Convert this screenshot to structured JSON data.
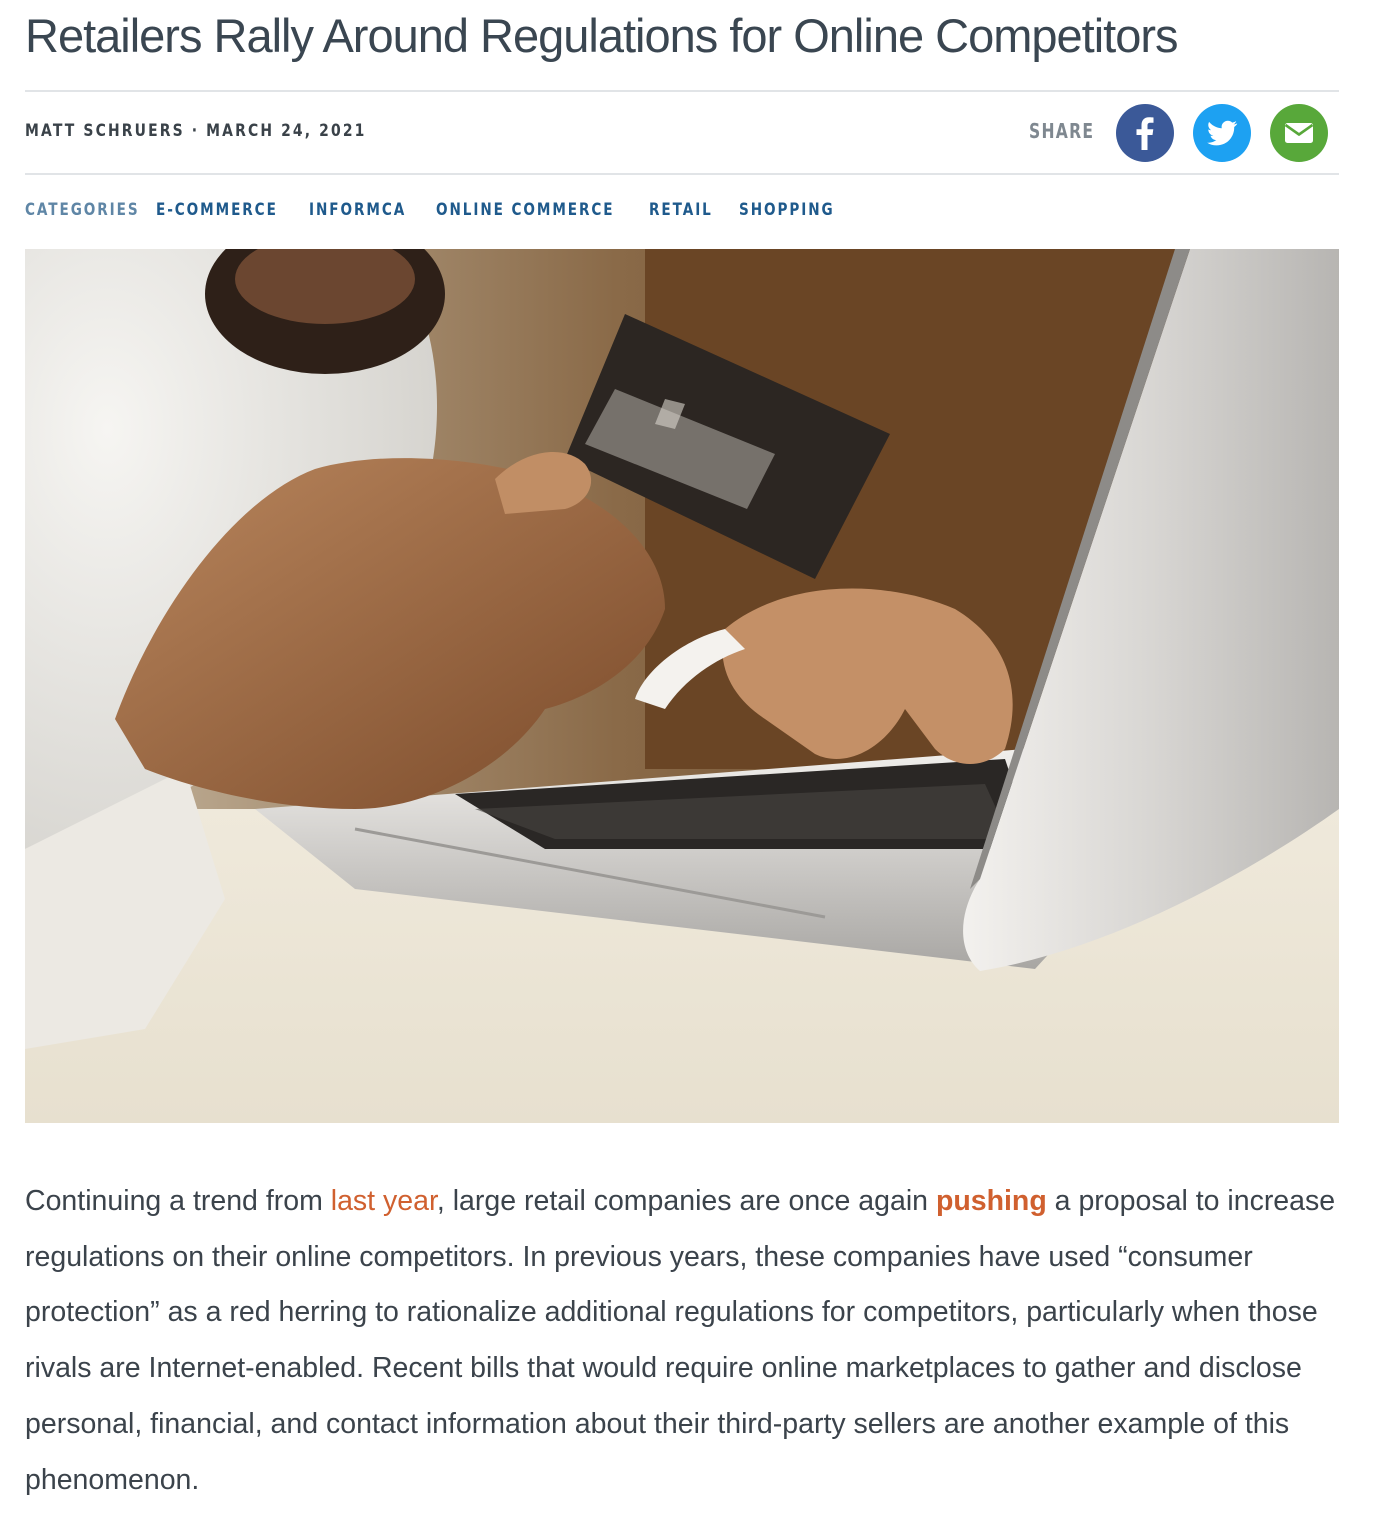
{
  "article": {
    "title": "Retailers Rally Around Regulations for Online Competitors",
    "byline": "MATT SCHRUERS · MARCH 24, 2021"
  },
  "share": {
    "label": "SHARE",
    "buttons": [
      {
        "icon": "facebook-icon",
        "color": "#3b5998"
      },
      {
        "icon": "twitter-icon",
        "color": "#1da1f2"
      },
      {
        "icon": "email-icon",
        "color": "#58a83a"
      }
    ]
  },
  "categories": {
    "label": "CATEGORIES",
    "items": [
      "E-COMMERCE",
      "INFORMCA",
      "ONLINE COMMERCE",
      "RETAIL",
      "SHOPPING"
    ]
  },
  "body": {
    "p1_before_link1": "Continuing a trend from ",
    "link1": "last year",
    "p1_between": ", large retail companies are once again ",
    "link2": "pushing",
    "p1_after": " a proposal to increase regulations on their online competitors.  In previous years, these companies have used “consumer protection” as a red herring to rationalize additional regulations for competitors, particularly when those rivals are Internet-enabled.  Recent bills that would require online marketplaces to gather and disclose personal, financial, and contact information about their third-party sellers are another example of this phenomenon."
  },
  "colors": {
    "link": "#d0602f",
    "category_link": "#1f5a8c",
    "category_label": "#5f86a6"
  }
}
